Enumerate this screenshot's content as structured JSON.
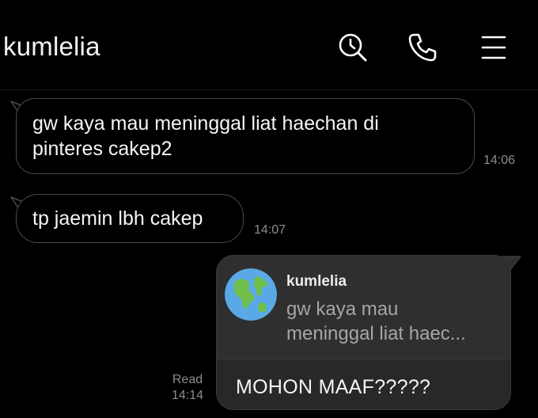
{
  "header": {
    "title": "kumlelia",
    "icons": [
      "search-icon",
      "phone-icon",
      "menu-icon"
    ]
  },
  "messages": [
    {
      "direction": "incoming",
      "lines": [
        "gw kaya mau meninggal liat haechan di",
        "pinteres cakep2"
      ],
      "time": "14:06"
    },
    {
      "direction": "incoming",
      "lines": [
        "tp jaemin lbh cakep"
      ],
      "time": "14:07"
    },
    {
      "direction": "outgoing",
      "quote": {
        "sender": "kumlelia",
        "lines": [
          "gw kaya mau",
          "meninggal liat haec..."
        ],
        "avatar_icon": "globe-avatar-icon"
      },
      "text": "MOHON MAAF?????",
      "status": "Read",
      "time": "14:14"
    }
  ],
  "colors": {
    "background": "#000000",
    "incoming_border": "#4a4a4a",
    "outgoing_bg": "#282828",
    "timestamp": "#8c8c8c"
  }
}
